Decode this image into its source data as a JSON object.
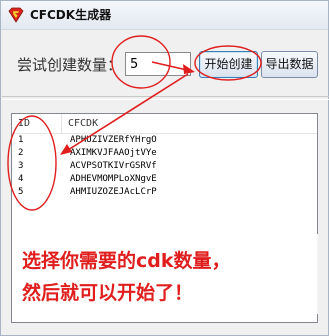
{
  "window": {
    "title": "CFCDK生成器",
    "icon": "superman-logo-icon"
  },
  "controls": {
    "count_label": "尝试创建数量：",
    "count_value": "5",
    "start_button": "开始创建",
    "export_button": "导出数据"
  },
  "list": {
    "columns": [
      "ID",
      "CFCDK"
    ],
    "rows": [
      {
        "id": "1",
        "cdk": "APHUZIVZERfYHrgO"
      },
      {
        "id": "2",
        "cdk": "AXIMKVJFAAOjtVYe"
      },
      {
        "id": "3",
        "cdk": "ACVPSOTKIVrGSRVf"
      },
      {
        "id": "4",
        "cdk": "ADHEVMOMPLoXNgvE"
      },
      {
        "id": "5",
        "cdk": "AHMIUZOZEJAcLCrP"
      }
    ]
  },
  "annotation": {
    "line1": "选择你需要的cdk数量，",
    "line2": "然后就可以开始了！",
    "color": "#e01e1e"
  },
  "colors": {
    "accent": "#e01e1e",
    "button_focus_border": "#3c7fb1"
  }
}
